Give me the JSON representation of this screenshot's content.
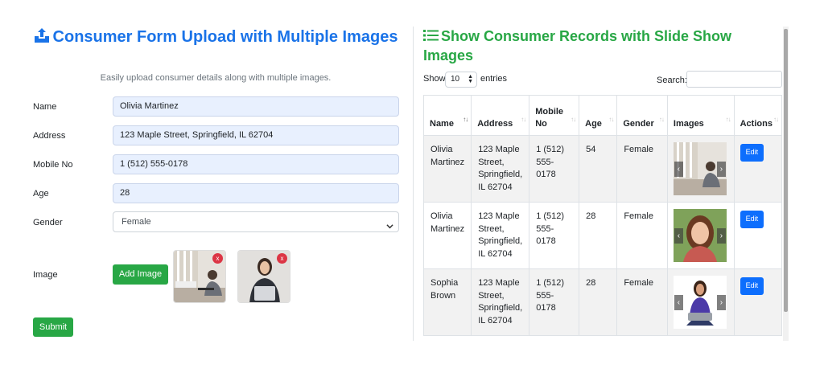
{
  "form": {
    "title": "Consumer Form Upload with Multiple Images",
    "subtitle": "Easily upload consumer details along with multiple images.",
    "title_icon": "upload-icon",
    "fields": {
      "name": {
        "label": "Name",
        "value": "Olivia Martinez"
      },
      "address": {
        "label": "Address",
        "value": "123 Maple Street, Springfield, IL 62704"
      },
      "mobile": {
        "label": "Mobile No",
        "value": "1 (512) 555-0178"
      },
      "age": {
        "label": "Age",
        "value": "28"
      },
      "gender": {
        "label": "Gender",
        "value": "Female"
      },
      "image": {
        "label": "Image"
      }
    },
    "add_image_label": "Add Image",
    "remove_label": "x",
    "submit_label": "Submit"
  },
  "records": {
    "title": "Show Consumer Records with Slide Show Images",
    "title_icon": "list-icon",
    "show_label": "Show",
    "page_length": "10",
    "entries_label": "entries",
    "search_label": "Search:",
    "columns": [
      "Name",
      "Address",
      "Mobile No",
      "Age",
      "Gender",
      "Images",
      "Actions"
    ],
    "rows": [
      {
        "name": "Olivia Martinez",
        "address": "123 Maple Street, Springfield, IL 62704",
        "mobile": "1 (512) 555-0178",
        "age": "54",
        "gender": "Female",
        "action": "Edit"
      },
      {
        "name": "Olivia Martinez",
        "address": "123 Maple Street, Springfield, IL 62704",
        "mobile": "1 (512) 555-0178",
        "age": "28",
        "gender": "Female",
        "action": "Edit"
      },
      {
        "name": "Sophia Brown",
        "address": "123 Maple Street, Springfield, IL 62704",
        "mobile": "1 (512) 555-0178",
        "age": "28",
        "gender": "Female",
        "action": "Edit"
      }
    ],
    "prev_arrow": "‹",
    "next_arrow": "›"
  },
  "colors": {
    "title_blue": "#1a73e8",
    "title_green": "#28a745",
    "button_green": "#28a745",
    "edit_blue": "#0d6efd"
  }
}
